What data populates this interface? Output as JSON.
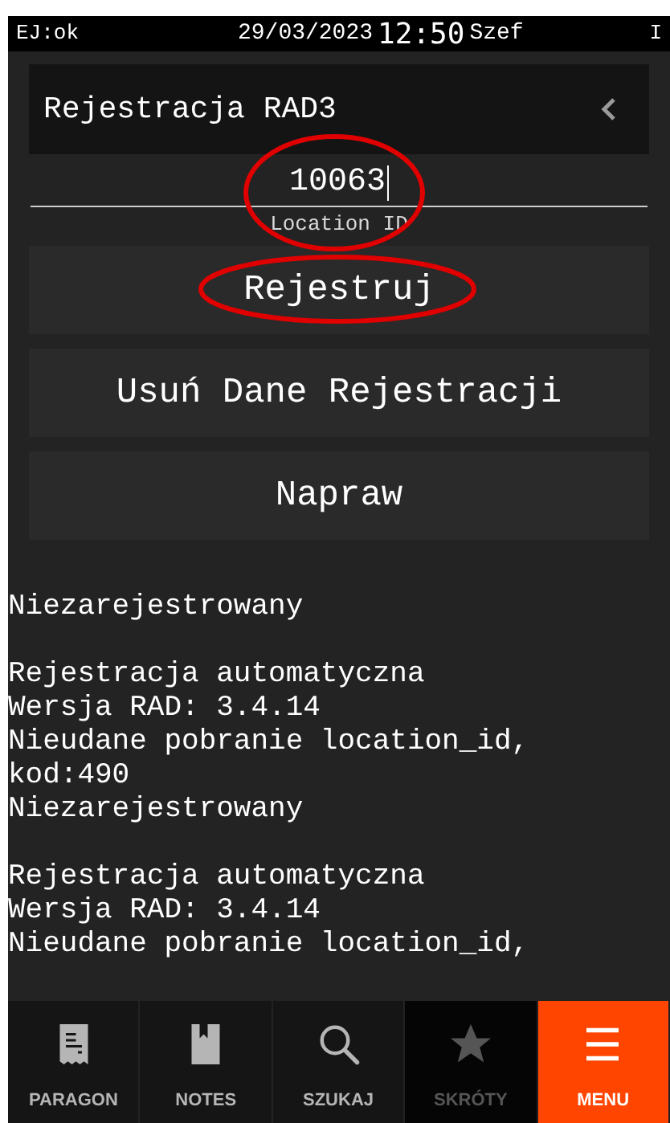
{
  "status_bar": {
    "left": "EJ:ok",
    "date": "29/03/2023",
    "time": "12:50",
    "user": "Szef",
    "right": "I"
  },
  "header": {
    "title": "Rejestracja RAD3"
  },
  "location_field": {
    "value": "10063",
    "label": "Location ID"
  },
  "buttons": [
    "Rejestruj",
    "Usuń Dane Rejestracji",
    "Napraw"
  ],
  "log": [
    {
      "lines": [
        "Niezarejestrowany"
      ]
    },
    {
      "lines": [
        "Rejestracja automatyczna",
        "Wersja RAD: 3.4.14",
        "Nieudane pobranie location_id,",
        "kod:490",
        "Niezarejestrowany"
      ]
    },
    {
      "lines": [
        "Rejestracja automatyczna",
        "Wersja RAD: 3.4.14",
        "Nieudane pobranie location_id,"
      ]
    }
  ],
  "nav": [
    {
      "kind": "receipt",
      "label": "PARAGON",
      "selected": false,
      "disabled": false
    },
    {
      "kind": "notes",
      "label": "NOTES",
      "selected": false,
      "disabled": false
    },
    {
      "kind": "search",
      "label": "SZUKAJ",
      "selected": false,
      "disabled": false
    },
    {
      "kind": "star",
      "label": "SKRÓTY",
      "selected": false,
      "disabled": true
    },
    {
      "kind": "menu",
      "label": "MENU",
      "selected": true,
      "disabled": false
    }
  ]
}
